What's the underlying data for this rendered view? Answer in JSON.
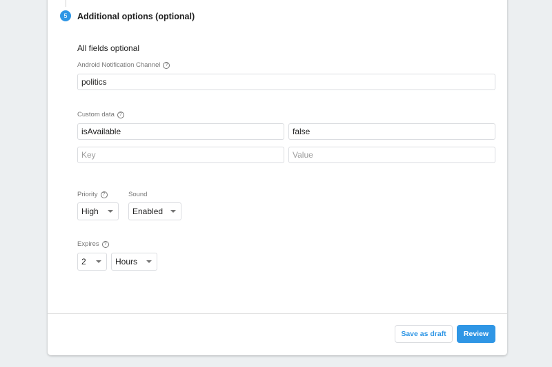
{
  "step": {
    "number": "5",
    "title": "Additional options (optional)"
  },
  "subtitle": "All fields optional",
  "notification_channel": {
    "label": "Android Notification Channel",
    "value": "politics"
  },
  "custom_data": {
    "label": "Custom data",
    "rows": [
      {
        "key": "isAvailable",
        "value": "false"
      },
      {
        "key": "",
        "value": ""
      }
    ],
    "key_placeholder": "Key",
    "value_placeholder": "Value"
  },
  "priority": {
    "label": "Priority",
    "value": "High"
  },
  "sound": {
    "label": "Sound",
    "value": "Enabled"
  },
  "expires": {
    "label": "Expires",
    "amount": "2",
    "unit": "Hours"
  },
  "buttons": {
    "save_draft": "Save as draft",
    "review": "Review"
  },
  "help_glyph": "?"
}
